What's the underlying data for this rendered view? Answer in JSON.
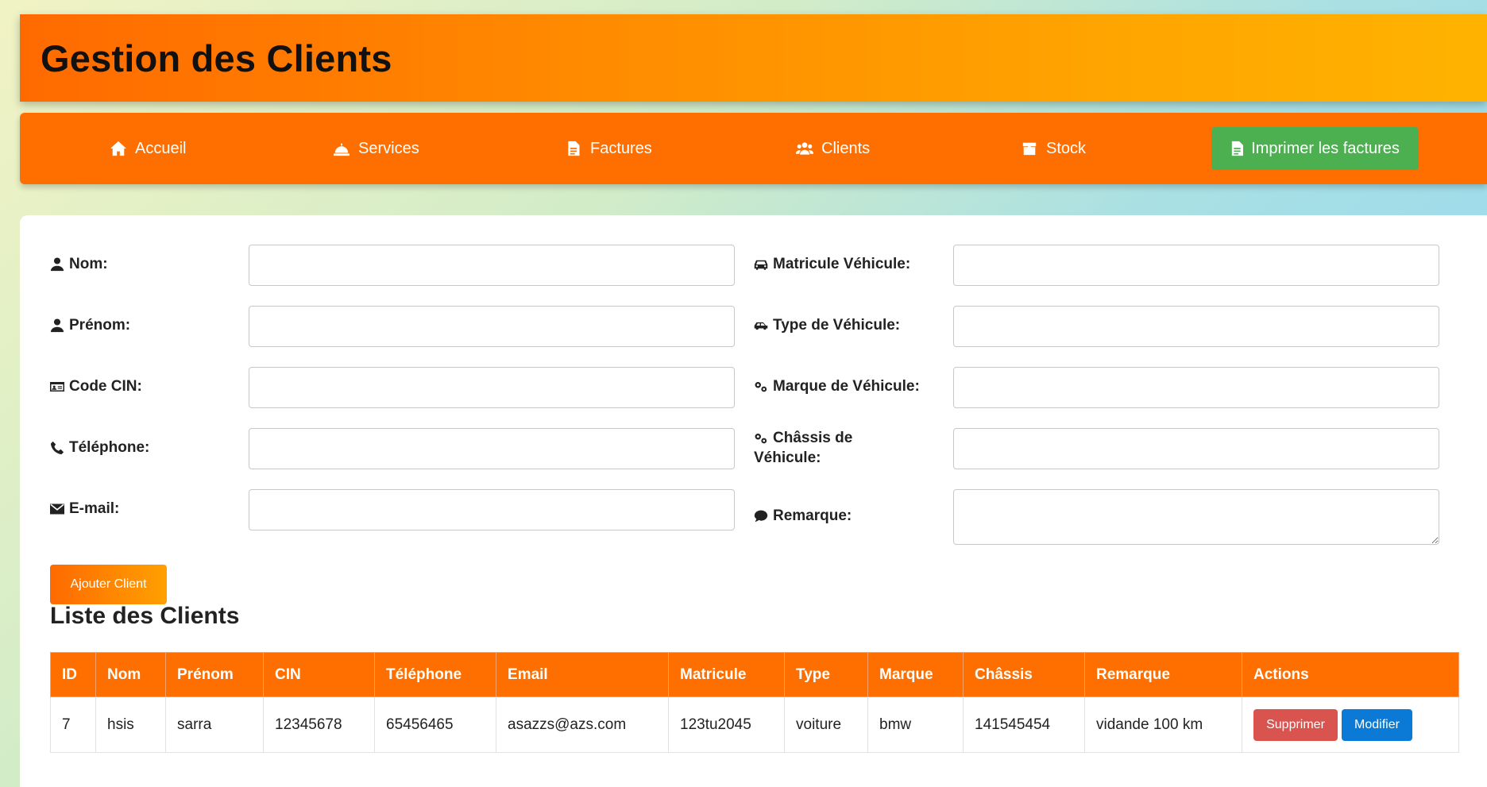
{
  "header": {
    "title": "Gestion des Clients"
  },
  "nav": {
    "items": [
      {
        "label": "Accueil",
        "icon": "home-icon"
      },
      {
        "label": "Services",
        "icon": "bell-icon"
      },
      {
        "label": "Factures",
        "icon": "file-icon"
      },
      {
        "label": "Clients",
        "icon": "users-icon"
      },
      {
        "label": "Stock",
        "icon": "box-icon"
      }
    ],
    "print_label": "Imprimer les factures"
  },
  "form": {
    "nom": {
      "label": "Nom:",
      "value": ""
    },
    "prenom": {
      "label": "Prénom:",
      "value": ""
    },
    "cin": {
      "label": "Code CIN:",
      "value": ""
    },
    "telephone": {
      "label": "Téléphone:",
      "value": ""
    },
    "email": {
      "label": "E-mail:",
      "value": ""
    },
    "matricule": {
      "label": "Matricule Véhicule:",
      "value": ""
    },
    "type": {
      "label": "Type de Véhicule:",
      "value": ""
    },
    "marque": {
      "label": "Marque de Véhicule:",
      "value": ""
    },
    "chassis": {
      "label_line1": "Châssis de",
      "label_line2": "Véhicule:",
      "value": ""
    },
    "remarque": {
      "label": "Remarque:",
      "value": ""
    },
    "submit_label": "Ajouter Client"
  },
  "list": {
    "title": "Liste des Clients",
    "columns": [
      "ID",
      "Nom",
      "Prénom",
      "CIN",
      "Téléphone",
      "Email",
      "Matricule",
      "Type",
      "Marque",
      "Châssis",
      "Remarque",
      "Actions"
    ],
    "rows": [
      {
        "id": "7",
        "nom": "hsis",
        "prenom": "sarra",
        "cin": "12345678",
        "telephone": "65456465",
        "email": "asazzs@azs.com",
        "matricule": "123tu2045",
        "type": "voiture",
        "marque": "bmw",
        "chassis": "141545454",
        "remarque": "vidande 100 km"
      }
    ],
    "delete_label": "Supprimer",
    "edit_label": "Modifier"
  },
  "colors": {
    "nav": "#ff6f00",
    "print": "#4caf50",
    "delete": "#d9534f",
    "edit": "#0a7ad6"
  }
}
